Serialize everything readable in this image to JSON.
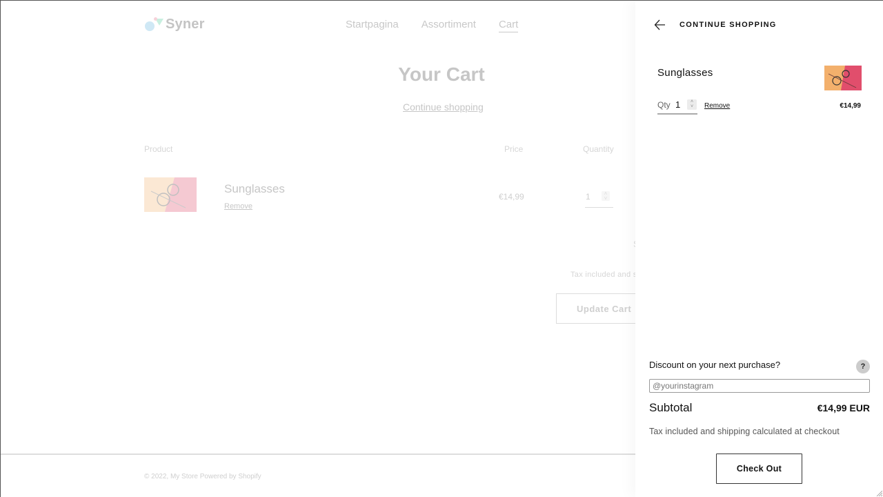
{
  "store": {
    "logo_text": "Syner",
    "nav": [
      {
        "label": "Startpagina",
        "active": false
      },
      {
        "label": "Assortiment",
        "active": false
      },
      {
        "label": "Cart",
        "active": true
      }
    ]
  },
  "cart_page": {
    "title": "Your Cart",
    "continue_link": "Continue shopping",
    "columns": {
      "product": "Product",
      "price": "Price",
      "quantity": "Quantity"
    },
    "item": {
      "name": "Sunglasses",
      "remove": "Remove",
      "price": "€14,99",
      "quantity": "1"
    },
    "subtotal_fragment": "S",
    "tax_fragment": "Tax included and s",
    "update_button": "Update Cart",
    "footer": "© 2022, My Store  Powered by Shopify"
  },
  "drawer": {
    "back_label": "CONTINUE SHOPPING",
    "item": {
      "name": "Sunglasses",
      "qty_label": "Qty",
      "qty_value": "1",
      "remove": "Remove",
      "price": "€14,99"
    },
    "discount_label": "Discount on your next purchase?",
    "help": "?",
    "discount_placeholder": "@yourinstagram",
    "subtotal_label": "Subtotal",
    "subtotal_value": "€14,99 EUR",
    "tax_note": "Tax included and shipping calculated at checkout",
    "checkout_button": "Check Out"
  }
}
